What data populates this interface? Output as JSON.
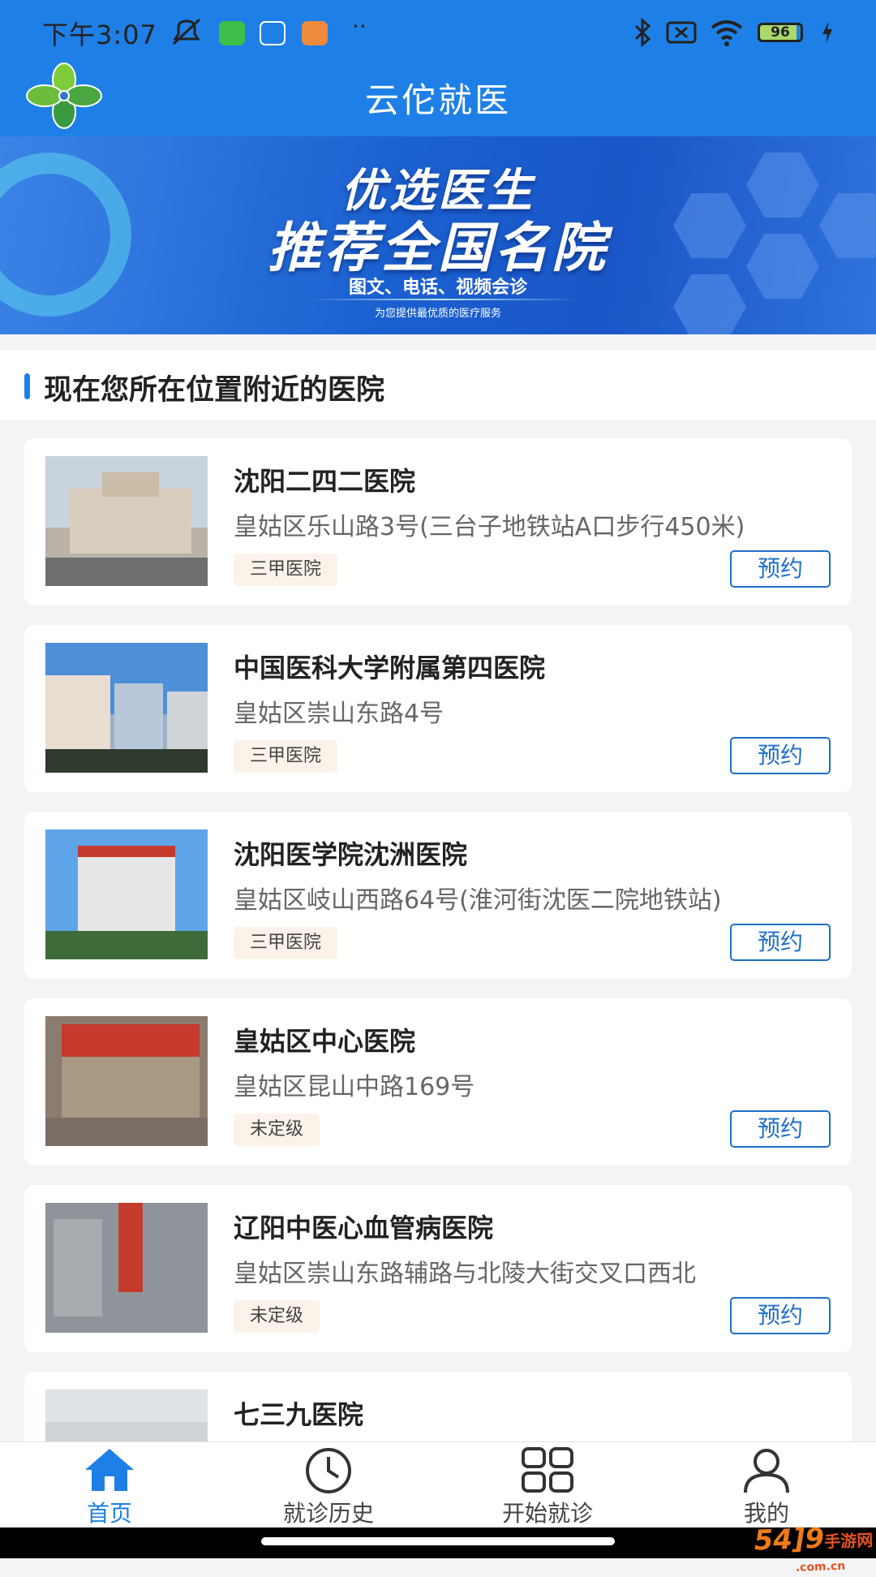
{
  "status_bar": {
    "time": "下午3:07",
    "battery": "96",
    "icons": [
      "mute-icon",
      "app-icon-green",
      "app-icon-blue",
      "app-icon-orange",
      "more-dots-icon",
      "bluetooth-icon",
      "sim-icon",
      "wifi-icon",
      "battery-icon",
      "charging-icon"
    ]
  },
  "header": {
    "title": "云佗就医",
    "logo": "clover-logo"
  },
  "banner": {
    "line1": "优选医生",
    "line2": "推荐全国名院",
    "line3": "图文、电话、视频会诊",
    "line4": "为您提供最优质的医疗服务"
  },
  "section": {
    "title": "现在您所在位置附近的医院"
  },
  "hospitals": [
    {
      "name": "沈阳二四二医院",
      "address": "皇姑区乐山路3号(三台子地铁站A口步行450米)",
      "grade": "三甲医院",
      "action": "预约"
    },
    {
      "name": "中国医科大学附属第四医院",
      "address": "皇姑区崇山东路4号",
      "grade": "三甲医院",
      "action": "预约"
    },
    {
      "name": "沈阳医学院沈洲医院",
      "address": "皇姑区岐山西路64号(淮河街沈医二院地铁站)",
      "grade": "三甲医院",
      "action": "预约"
    },
    {
      "name": "皇姑区中心医院",
      "address": "皇姑区昆山中路169号",
      "grade": "未定级",
      "action": "预约"
    },
    {
      "name": "辽阳中医心血管病医院",
      "address": "皇姑区崇山东路辅路与北陵大街交叉口西北",
      "grade": "未定级",
      "action": "预约"
    },
    {
      "name": "七三九医院",
      "address": "",
      "grade": "",
      "action": ""
    }
  ],
  "bottom_nav": [
    {
      "label": "首页",
      "icon": "home-icon",
      "active": true
    },
    {
      "label": "就诊历史",
      "icon": "clock-icon",
      "active": false
    },
    {
      "label": "开始就诊",
      "icon": "grid-icon",
      "active": false
    },
    {
      "label": "我的",
      "icon": "user-icon",
      "active": false
    }
  ],
  "watermark": {
    "brand": "54]9",
    "text": "手游网",
    "domain": ".com.cn"
  },
  "colors": {
    "primary": "#1e80e6",
    "book_border": "#1e6fc7",
    "grade_bg": "#fbf3ea"
  }
}
